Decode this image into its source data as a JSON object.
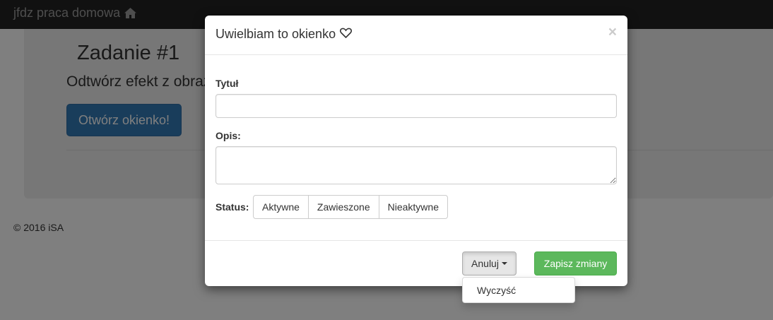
{
  "navbar": {
    "brand": "jfdz praca domowa",
    "brand_icon": "home-icon"
  },
  "page": {
    "title": "Zadanie #1",
    "lead": "Odtwórz efekt z obrazka",
    "open_button": "Otwórz okienko!"
  },
  "footer": {
    "text": "© 2016 iSA"
  },
  "modal": {
    "title": "Uwielbiam to okienko",
    "title_icon": "heart-icon",
    "close_label": "×",
    "form": {
      "title_label": "Tytuł",
      "title_value": "",
      "description_label": "Opis:",
      "description_value": "",
      "status_label": "Status:",
      "status_options": [
        "Aktywne",
        "Zawieszone",
        "Nieaktywne"
      ]
    },
    "footer": {
      "cancel_label": "Anuluj",
      "save_label": "Zapisz zmiany",
      "dropdown_items": [
        "Wyczyść"
      ]
    }
  },
  "colors": {
    "primary": "#337ab7",
    "success": "#5cb85c",
    "navbar": "#222222"
  }
}
